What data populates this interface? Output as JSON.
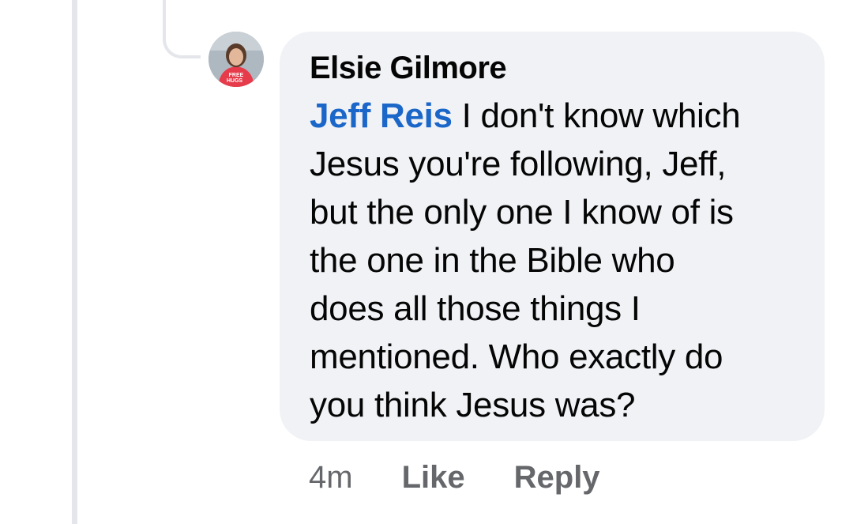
{
  "comment": {
    "author": "Elsie Gilmore",
    "mention": "Jeff Reis",
    "lines": [
      " I don't know which",
      "Jesus you're following, Jeff,",
      "but the only one I know of is",
      "the one in the Bible who",
      "does all those things I",
      "mentioned. Who exactly do",
      "you think Jesus was?"
    ],
    "avatar_shirt_text": [
      "FREE",
      "HUGS"
    ]
  },
  "actions": {
    "timestamp": "4m",
    "like_label": "Like",
    "reply_label": "Reply"
  },
  "colors": {
    "bubble_bg": "#f0f2f5",
    "mention": "#1b66c9",
    "meta_text": "#65676b",
    "thread_line": "#e4e6eb"
  }
}
